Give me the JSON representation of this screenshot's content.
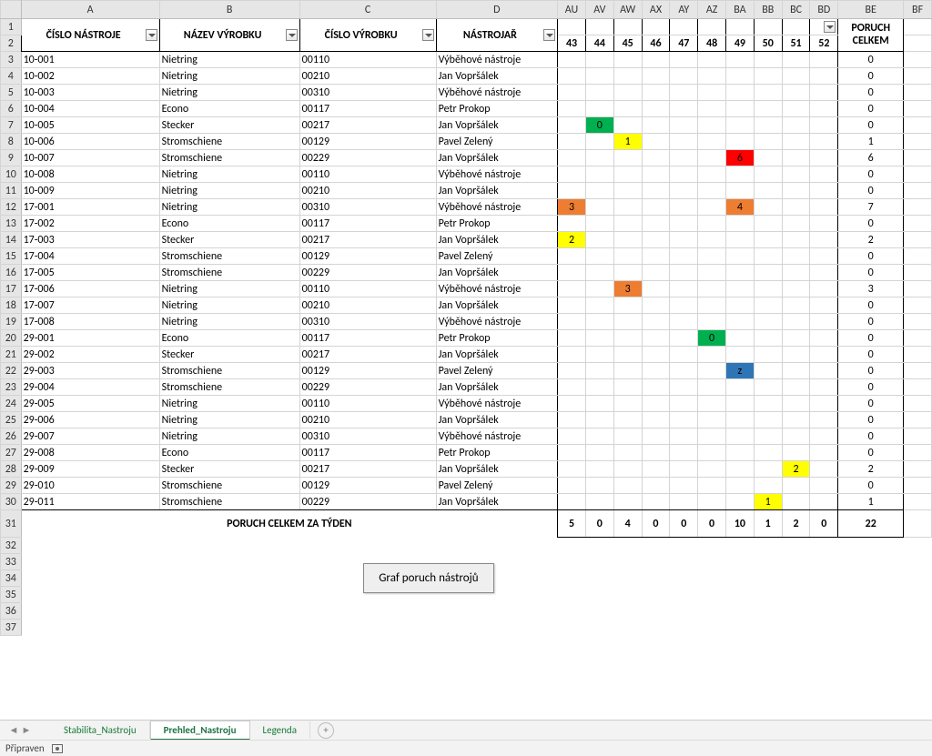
{
  "columns": [
    "A",
    "B",
    "C",
    "D",
    "AU",
    "AV",
    "AW",
    "AX",
    "AY",
    "AZ",
    "BA",
    "BB",
    "BC",
    "BD",
    "BE",
    "BF"
  ],
  "headers": {
    "tool_number": "ČÍSLO NÁSTROJE",
    "product_name": "NÁZEV VÝROBKU",
    "product_number": "ČÍSLO VÝROBKU",
    "toolmaker": "NÁSTROJAŘ",
    "faults_total": "PORUCH CELKEM"
  },
  "weeks": [
    "43",
    "44",
    "45",
    "46",
    "47",
    "48",
    "49",
    "50",
    "51",
    "52"
  ],
  "rows": [
    {
      "n": "3",
      "a": "10-001",
      "b": "Nietring",
      "c": "00110",
      "d": "Výběhové nástroje",
      "wk": {},
      "sum": "0"
    },
    {
      "n": "4",
      "a": "10-002",
      "b": "Nietring",
      "c": "00210",
      "d": "Jan Vopršálek",
      "wk": {},
      "sum": "0"
    },
    {
      "n": "5",
      "a": "10-003",
      "b": "Nietring",
      "c": "00310",
      "d": "Výběhové nástroje",
      "wk": {},
      "sum": "0"
    },
    {
      "n": "6",
      "a": "10-004",
      "b": "Econo",
      "c": "00117",
      "d": "Petr Prokop",
      "wk": {},
      "sum": "0"
    },
    {
      "n": "7",
      "a": "10-005",
      "b": "Stecker",
      "c": "00217",
      "d": "Jan Vopršálek",
      "wk": {
        "44": {
          "v": "0",
          "cls": "bg-green"
        }
      },
      "sum": "0"
    },
    {
      "n": "8",
      "a": "10-006",
      "b": "Stromschiene",
      "c": "00129",
      "d": "Pavel Zelený",
      "wk": {
        "45": {
          "v": "1",
          "cls": "bg-yellow"
        }
      },
      "sum": "1"
    },
    {
      "n": "9",
      "a": "10-007",
      "b": "Stromschiene",
      "c": "00229",
      "d": "Jan Vopršálek",
      "wk": {
        "49": {
          "v": "6",
          "cls": "bg-red"
        }
      },
      "sum": "6"
    },
    {
      "n": "10",
      "a": "10-008",
      "b": "Nietring",
      "c": "00110",
      "d": "Výběhové nástroje",
      "wk": {},
      "sum": "0"
    },
    {
      "n": "11",
      "a": "10-009",
      "b": "Nietring",
      "c": "00210",
      "d": "Jan Vopršálek",
      "wk": {},
      "sum": "0"
    },
    {
      "n": "12",
      "a": "17-001",
      "b": "Nietring",
      "c": "00310",
      "d": "Výběhové nástroje",
      "wk": {
        "43": {
          "v": "3",
          "cls": "bg-orange"
        },
        "49": {
          "v": "4",
          "cls": "bg-orange"
        }
      },
      "sum": "7"
    },
    {
      "n": "13",
      "a": "17-002",
      "b": "Econo",
      "c": "00117",
      "d": "Petr Prokop",
      "wk": {},
      "sum": "0"
    },
    {
      "n": "14",
      "a": "17-003",
      "b": "Stecker",
      "c": "00217",
      "d": "Jan Vopršálek",
      "wk": {
        "43": {
          "v": "2",
          "cls": "bg-yellow"
        }
      },
      "sum": "2"
    },
    {
      "n": "15",
      "a": "17-004",
      "b": "Stromschiene",
      "c": "00129",
      "d": "Pavel Zelený",
      "wk": {},
      "sum": "0"
    },
    {
      "n": "16",
      "a": "17-005",
      "b": "Stromschiene",
      "c": "00229",
      "d": "Jan Vopršálek",
      "wk": {},
      "sum": "0"
    },
    {
      "n": "17",
      "a": "17-006",
      "b": "Nietring",
      "c": "00110",
      "d": "Výběhové nástroje",
      "wk": {
        "45": {
          "v": "3",
          "cls": "bg-orange"
        }
      },
      "sum": "3"
    },
    {
      "n": "18",
      "a": "17-007",
      "b": "Nietring",
      "c": "00210",
      "d": "Jan Vopršálek",
      "wk": {},
      "sum": "0"
    },
    {
      "n": "19",
      "a": "17-008",
      "b": "Nietring",
      "c": "00310",
      "d": "Výběhové nástroje",
      "wk": {},
      "sum": "0"
    },
    {
      "n": "20",
      "a": "29-001",
      "b": "Econo",
      "c": "00117",
      "d": "Petr Prokop",
      "wk": {
        "48": {
          "v": "0",
          "cls": "bg-green"
        }
      },
      "sum": "0"
    },
    {
      "n": "21",
      "a": "29-002",
      "b": "Stecker",
      "c": "00217",
      "d": "Jan Vopršálek",
      "wk": {},
      "sum": "0"
    },
    {
      "n": "22",
      "a": "29-003",
      "b": "Stromschiene",
      "c": "00129",
      "d": "Pavel Zelený",
      "wk": {
        "49": {
          "v": "z",
          "cls": "bg-blue"
        }
      },
      "sum": "0"
    },
    {
      "n": "23",
      "a": "29-004",
      "b": "Stromschiene",
      "c": "00229",
      "d": "Jan Vopršálek",
      "wk": {},
      "sum": "0"
    },
    {
      "n": "24",
      "a": "29-005",
      "b": "Nietring",
      "c": "00110",
      "d": "Výběhové nástroje",
      "wk": {},
      "sum": "0"
    },
    {
      "n": "25",
      "a": "29-006",
      "b": "Nietring",
      "c": "00210",
      "d": "Jan Vopršálek",
      "wk": {},
      "sum": "0"
    },
    {
      "n": "26",
      "a": "29-007",
      "b": "Nietring",
      "c": "00310",
      "d": "Výběhové nástroje",
      "wk": {},
      "sum": "0"
    },
    {
      "n": "27",
      "a": "29-008",
      "b": "Econo",
      "c": "00117",
      "d": "Petr Prokop",
      "wk": {},
      "sum": "0"
    },
    {
      "n": "28",
      "a": "29-009",
      "b": "Stecker",
      "c": "00217",
      "d": "Jan Vopršálek",
      "wk": {
        "51": {
          "v": "2",
          "cls": "bg-yellow"
        }
      },
      "sum": "2"
    },
    {
      "n": "29",
      "a": "29-010",
      "b": "Stromschiene",
      "c": "00129",
      "d": "Pavel Zelený",
      "wk": {},
      "sum": "0"
    },
    {
      "n": "30",
      "a": "29-011",
      "b": "Stromschiene",
      "c": "00229",
      "d": "Jan Vopršálek",
      "wk": {
        "50": {
          "v": "1",
          "cls": "bg-yellow"
        }
      },
      "sum": "1"
    }
  ],
  "totals_label": "PORUCH CELKEM ZA TÝDEN",
  "week_totals": [
    "5",
    "0",
    "4",
    "0",
    "0",
    "0",
    "10",
    "1",
    "2",
    "0"
  ],
  "grand_total": "22",
  "button_label": "Graf poruch nástrojů",
  "tabs": [
    "Stabilita_Nastroju",
    "Prehled_Nastroju",
    "Legenda"
  ],
  "active_tab": 1,
  "status": "Připraven"
}
